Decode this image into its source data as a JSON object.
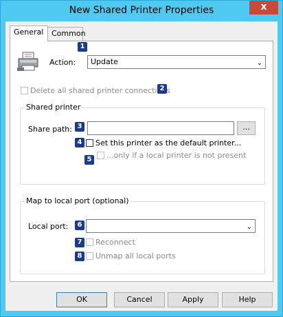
{
  "window": {
    "title": "New Shared Printer Properties",
    "close_label": "x"
  },
  "tabs": [
    {
      "label": "General"
    },
    {
      "label": "Common"
    }
  ],
  "general": {
    "action": {
      "badge": "1",
      "label": "Action:",
      "value": "Update"
    },
    "delete_all": {
      "badge": "2",
      "label": "Delete all shared printer connections"
    },
    "shared_printer": {
      "title": "Shared printer",
      "share_path": {
        "badge": "3",
        "label": "Share path:",
        "value": "",
        "browse_label": "..."
      },
      "set_default": {
        "badge": "4",
        "label": "Set this printer as the default printer..."
      },
      "only_if": {
        "badge": "5",
        "label": "...only if a local printer is not present"
      }
    },
    "map_port": {
      "title": "Map to local port (optional)",
      "local_port": {
        "badge": "6",
        "label": "Local port:",
        "value": ""
      },
      "reconnect": {
        "badge": "7",
        "label": "Reconnect"
      },
      "unmap": {
        "badge": "8",
        "label": "Unmap all local ports"
      }
    }
  },
  "buttons": {
    "ok": "OK",
    "cancel": "Cancel",
    "apply": "Apply",
    "help": "Help"
  },
  "colors": {
    "titlebar": "#4fc9f0",
    "close": "#c74a3b",
    "badge": "#1a3a8c"
  },
  "icons": {
    "printer": "printer-icon"
  }
}
